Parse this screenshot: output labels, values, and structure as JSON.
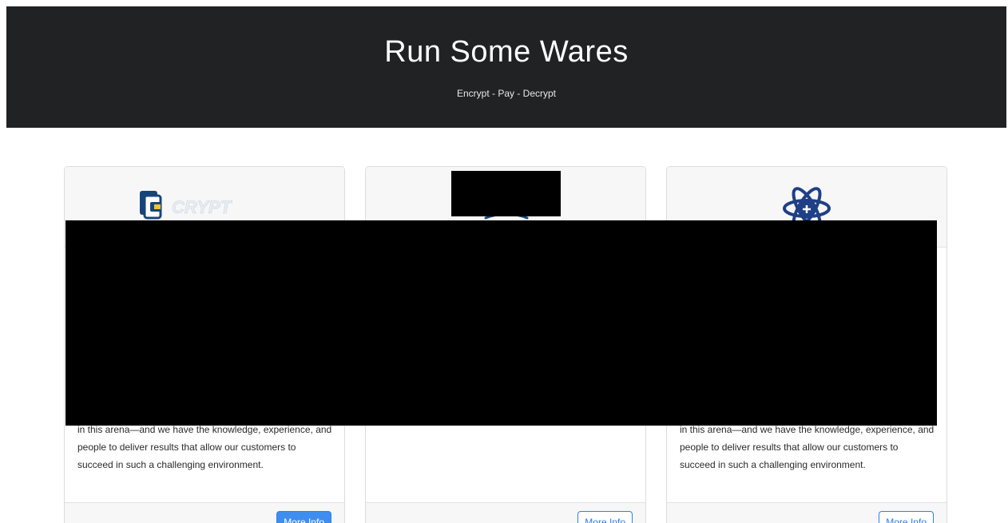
{
  "hero": {
    "title": "Run Some Wares",
    "subtitle": "Encrypt - Pay - Decrypt"
  },
  "cards": [
    {
      "logo_icon": "secure-file-logo-icon",
      "body_text": "in this arena—and we have the knowledge, experience, and people to deliver results that allow our customers to succeed in such a challenging environment.",
      "button_label": "More Info",
      "button_style": "primary"
    },
    {
      "logo_icon": "cloud-logo-icon",
      "body_text": "",
      "button_label": "More Info",
      "button_style": "outline"
    },
    {
      "logo_icon": "atom-shield-logo-icon",
      "body_text": "in this arena—and we have the knowledge, experience, and people to deliver results that allow our customers to succeed in such a challenging environment.",
      "button_label": "More Info",
      "button_style": "outline"
    }
  ],
  "colors": {
    "hero_background": "#202224",
    "button_primary": "#3e8ef0",
    "accent_blue": "#2f80e8",
    "logo_navy": "#17457a",
    "redaction": "#000000"
  }
}
